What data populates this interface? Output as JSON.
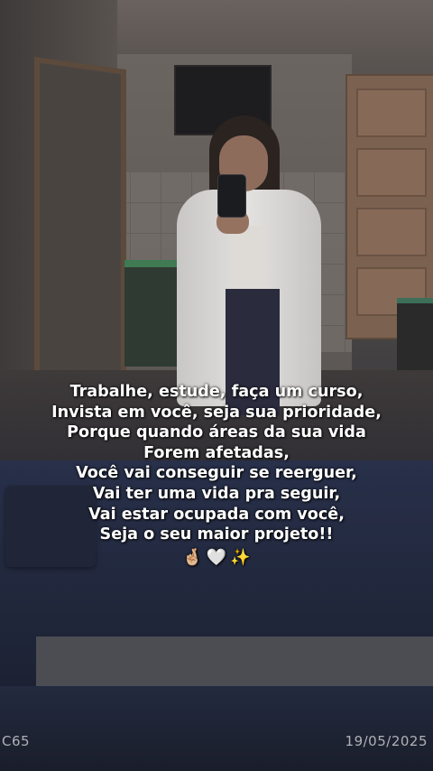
{
  "caption": {
    "lines": [
      "Trabalhe, estude, faça um curso,",
      "Invista em você, seja sua prioridade,",
      "Porque quando áreas da sua vida",
      "Forem afetadas,",
      "Você vai conseguir se reerguer,",
      "Vai ter uma vida pra seguir,",
      "Vai estar ocupada com você,",
      "Seja o seu maior projeto!!"
    ],
    "emojis": [
      "🤞🏼",
      "🤍",
      "✨"
    ]
  },
  "stamps": {
    "left": "C65",
    "right": "19/05/2025"
  }
}
